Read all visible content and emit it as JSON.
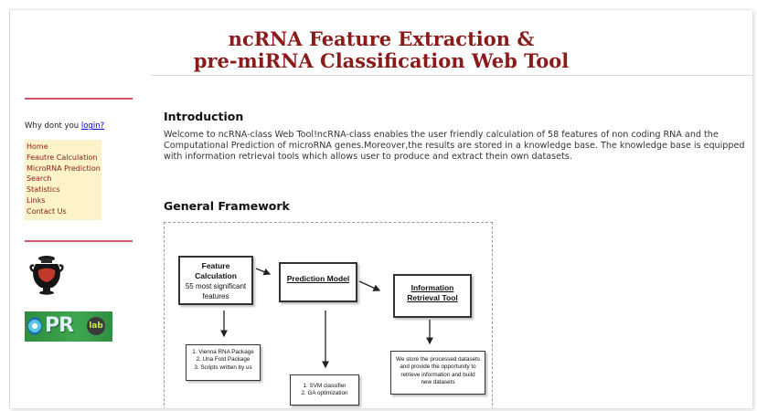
{
  "header": {
    "title_line1": "ncRNA Feature Extraction &",
    "title_line2": "pre-miRNA Classification Web Tool"
  },
  "sidebar": {
    "login_prompt": "Why dont you",
    "login_link": "login?",
    "nav_items": [
      {
        "label": "Home"
      },
      {
        "label": "Feautre Calculation"
      },
      {
        "label": "MicroRNA Prediction"
      },
      {
        "label": "Search"
      },
      {
        "label": "Statistics"
      },
      {
        "label": "Links"
      },
      {
        "label": "Contact Us"
      }
    ],
    "logo_text": "PR",
    "logo_sub": "lab"
  },
  "main": {
    "intro_heading": "Introduction",
    "intro_text": "Welcome to ncRNA-class Web Tool!ncRNA-class enables the user friendly calculation of 58 features of non coding RNA and the Computational Prediction of microRNA genes.Moreover,the results are stored in a knowledge base. The knowledge base is equipped with information retrieval tools which allows user to produce and extract thein own datasets.",
    "framework_heading": "General Framework"
  },
  "framework": {
    "feature_box": {
      "title": "Feature Calculation",
      "line2": "55 most significant",
      "line3": "features"
    },
    "prediction_box": {
      "title": "Prediction Model"
    },
    "retrieval_box": {
      "line1": "Information",
      "line2": "Retrieval Tool"
    },
    "packages_box": {
      "line1": "1. Vienna RNA Package",
      "line2": "2. Una Fold Package",
      "line3": "3. Scripts written by us"
    },
    "svm_box": {
      "line1": "1. SVM classifier",
      "line2": "2. GA optimization"
    },
    "store_box": {
      "line1": "We store the processed datasets",
      "line2": "and provide the opportunity to",
      "line3": "retrieve information and build",
      "line4": "new datasets"
    }
  },
  "colors": {
    "title": "#8b1a1a",
    "nav_bg": "#fdf3c8",
    "nav_text": "#8b1a1a",
    "rule": "#d5546a",
    "link": "#0000cc"
  },
  "icons": [
    "greek-vase-logo",
    "pr-lab-logo"
  ]
}
